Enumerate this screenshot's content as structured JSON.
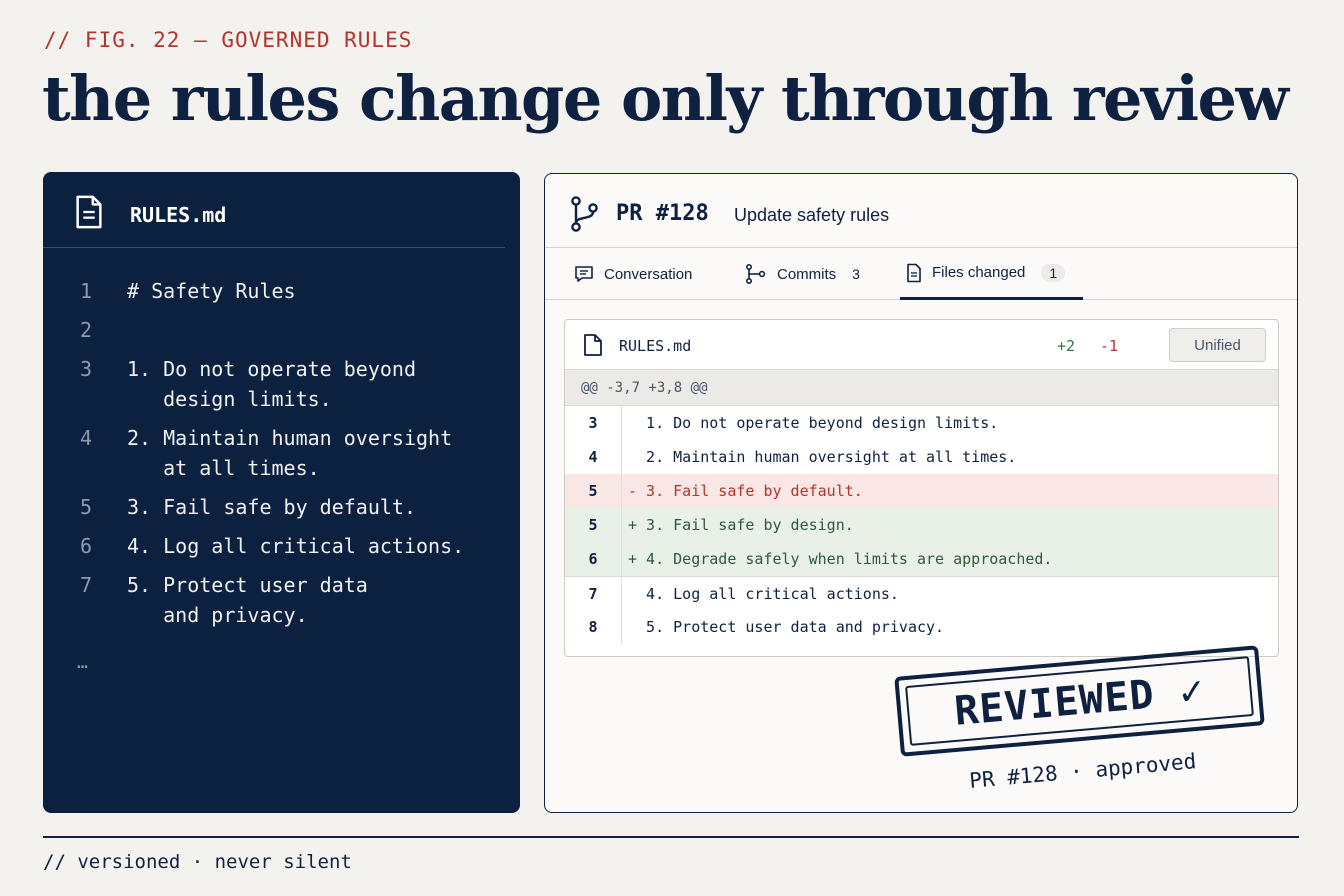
{
  "figure": {
    "label": "// FIG. 22 — GOVERNED RULES",
    "headline": "the rules change only through review",
    "footer": "// versioned · never silent"
  },
  "file_panel": {
    "file_name": "RULES.md",
    "icon": "document-icon",
    "lines": [
      {
        "num": "1",
        "text": "# Safety Rules"
      },
      {
        "num": "2",
        "text": ""
      },
      {
        "num": "3",
        "text": "1. Do not operate beyond\n   design limits."
      },
      {
        "num": "4",
        "text": "2. Maintain human oversight\n   at all times."
      },
      {
        "num": "5",
        "text": "3. Fail safe by default."
      },
      {
        "num": "6",
        "text": "4. Log all critical actions."
      },
      {
        "num": "7",
        "text": "5. Protect user data\n   and privacy."
      }
    ],
    "ellipsis": "…"
  },
  "pr_panel": {
    "icon": "git-branch-icon",
    "number": "PR #128",
    "title": "Update safety rules",
    "tabs": [
      {
        "label": "Conversation",
        "icon": "comment-icon",
        "count": ""
      },
      {
        "label": "Commits",
        "icon": "git-commit-icon",
        "count": "3"
      },
      {
        "label": "Files changed",
        "icon": "document-icon",
        "count": "1",
        "active": true
      }
    ],
    "diff": {
      "file_name": "RULES.md",
      "additions": "+2",
      "deletions": "-1",
      "view_button": "Unified",
      "hunk_header": "@@ -3,7 +3,8 @@",
      "rows": [
        {
          "num": "3",
          "type": "context",
          "text": "  1. Do not operate beyond design limits."
        },
        {
          "num": "4",
          "type": "context",
          "text": "  2. Maintain human oversight at all times."
        },
        {
          "num": "5",
          "type": "del",
          "text": "- 3. Fail safe by default."
        },
        {
          "num": "5",
          "type": "add",
          "text": "+ 3. Fail safe by design."
        },
        {
          "num": "6",
          "type": "add",
          "text": "+ 4. Degrade safely when limits are approached."
        },
        {
          "num": "7",
          "type": "context",
          "text": "  4. Log all critical actions."
        },
        {
          "num": "8",
          "type": "context",
          "text": "  5. Protect user data and privacy."
        }
      ]
    },
    "stamp": {
      "text": "REVIEWED ✓",
      "caption": "PR #128 · approved"
    }
  },
  "colors": {
    "navy": "#0f2140",
    "red_accent": "#b3342c",
    "green_accent": "#2f7a3e",
    "background": "#f4f2ee"
  }
}
